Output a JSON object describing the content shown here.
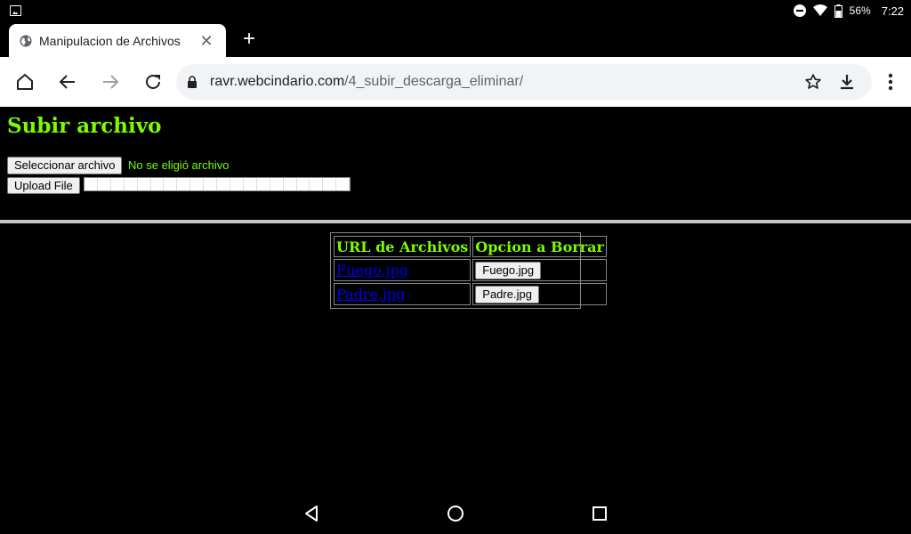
{
  "status_bar": {
    "battery": "56%",
    "time": "7:22"
  },
  "browser": {
    "tab_title": "Manipulacion de Archivos",
    "url_host": "ravr.webcindario.com",
    "url_path": "/4_subir_descarga_eliminar/"
  },
  "page": {
    "title": "Subir archivo",
    "choose_file_label": "Seleccionar archivo",
    "no_file_text": "No se eligió archivo",
    "upload_label": "Upload File",
    "progress": 0,
    "table": {
      "headers": [
        "URL de Archivos",
        "Opcion a Borrar"
      ],
      "rows": [
        {
          "link": "Fuego.jpg",
          "button": "Fuego.jpg"
        },
        {
          "link": "Padre.jpg",
          "button": "Padre.jpg"
        }
      ]
    }
  },
  "colors": {
    "accent_green": "#7cfc00",
    "link_blue": "#0000ee",
    "background": "#000000"
  }
}
